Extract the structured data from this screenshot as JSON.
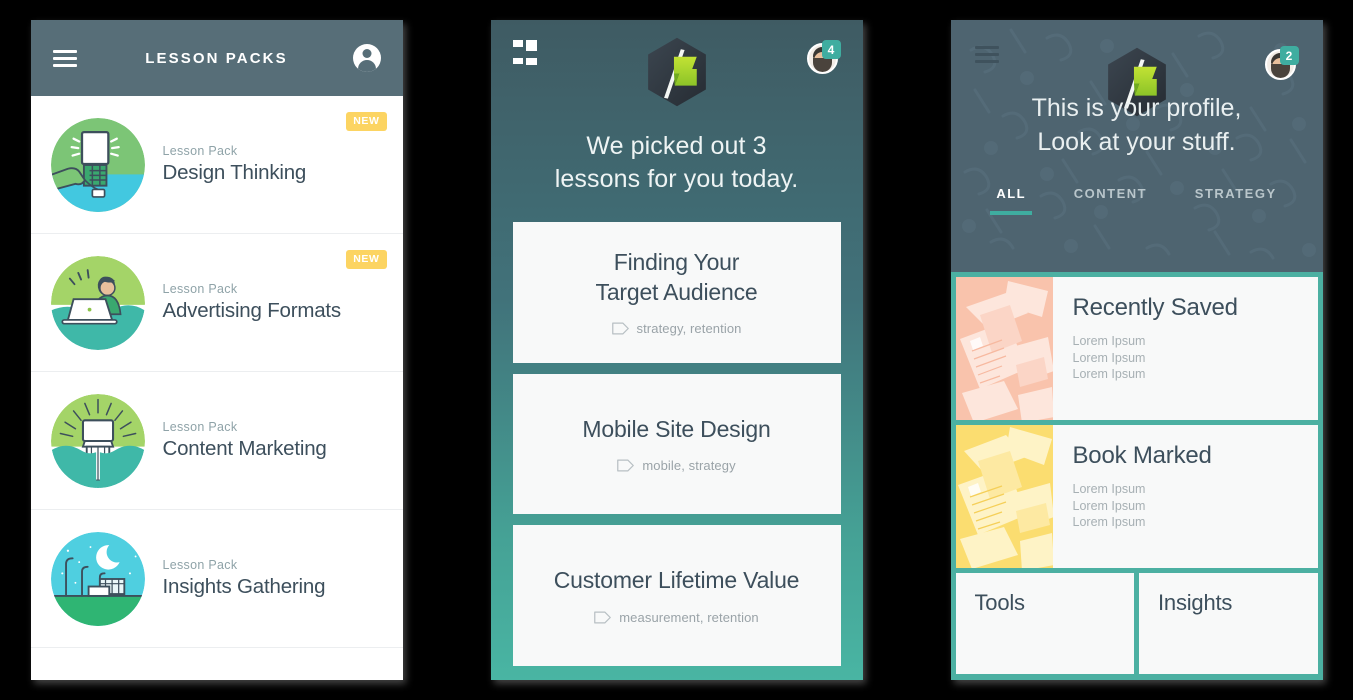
{
  "theme": {
    "page_background": "#000000",
    "header_slate": "#576e78",
    "teal_accent": "#3fada0",
    "body_teal": "#4cb0a2",
    "text_dark": "#3d4f5c",
    "badge_yellow": "#fcd462",
    "profile_slate": "#4e6470"
  },
  "phone1": {
    "header": {
      "title": "LESSON PACKS",
      "menu_icon": "hamburger-icon",
      "profile_icon": "account-circle-icon"
    },
    "packs": [
      {
        "kicker": "Lesson Pack",
        "title": "Design Thinking",
        "badge": "NEW",
        "thumb": "design-thinking-illustration"
      },
      {
        "kicker": "Lesson Pack",
        "title": "Advertising Formats",
        "badge": "NEW",
        "thumb": "advertising-formats-illustration"
      },
      {
        "kicker": "Lesson Pack",
        "title": "Content Marketing",
        "badge": "",
        "thumb": "content-marketing-illustration"
      },
      {
        "kicker": "Lesson Pack",
        "title": "Insights Gathering",
        "badge": "",
        "thumb": "insights-gathering-illustration"
      }
    ]
  },
  "phone2": {
    "header": {
      "grid_icon": "dashboard-grid-icon",
      "logo_icon": "hexagon-flag-logo",
      "avatar": "user-avatar",
      "notification_count": "4"
    },
    "heading_line1": "We picked out 3",
    "heading_line2": "lessons for you today.",
    "cards": [
      {
        "title_line1": "Finding Your",
        "title_line2": "Target Audience",
        "tags": "strategy, retention"
      },
      {
        "title_line1": "Mobile Site Design",
        "title_line2": "",
        "tags": "mobile, strategy"
      },
      {
        "title_line1": "Customer Lifetime Value",
        "title_line2": "",
        "tags": "measurement, retention"
      }
    ]
  },
  "phone3": {
    "header": {
      "menu_icon": "hamburger-icon",
      "logo_icon": "hexagon-flag-logo",
      "avatar": "user-avatar",
      "notification_count": "2"
    },
    "heading_line1": "This is your profile,",
    "heading_line2": "Look at your stuff.",
    "tabs": [
      {
        "label": "ALL",
        "active": true
      },
      {
        "label": "CONTENT",
        "active": false
      },
      {
        "label": "STRATEGY",
        "active": false
      }
    ],
    "saved_cards": [
      {
        "title": "Recently Saved",
        "thumb": "pink-papers-thumbnail",
        "lines": [
          "Lorem Ipsum",
          "Lorem Ipsum",
          "Lorem Ipsum"
        ]
      },
      {
        "title": "Book Marked",
        "thumb": "yellow-papers-thumbnail",
        "lines": [
          "Lorem Ipsum",
          "Lorem Ipsum",
          "Lorem Ipsum"
        ]
      }
    ],
    "mini_cards": [
      {
        "title": "Tools"
      },
      {
        "title": "Insights"
      }
    ]
  }
}
